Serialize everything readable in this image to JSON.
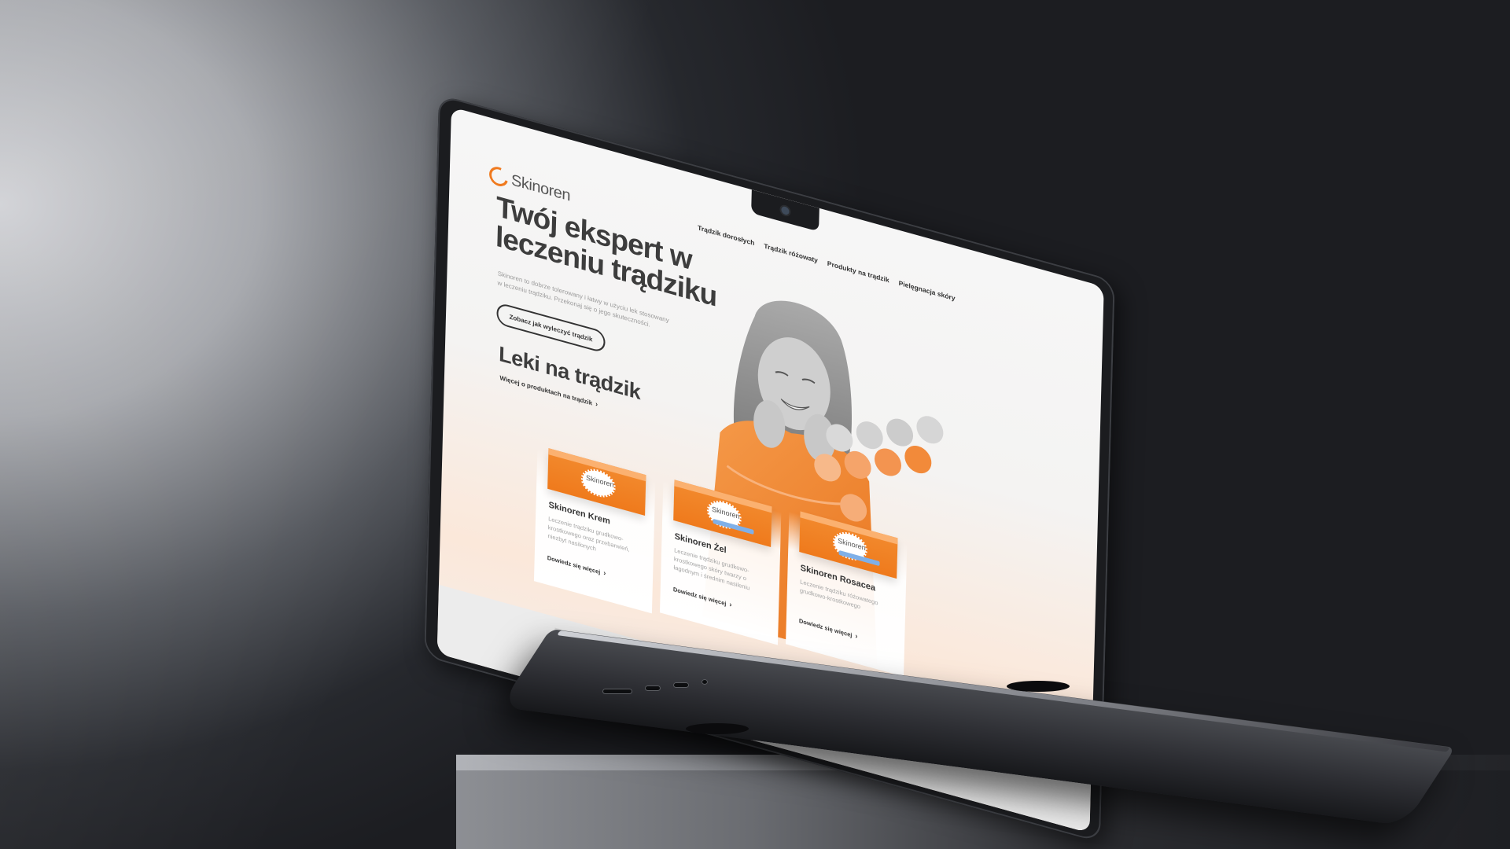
{
  "site": {
    "logo_text": "Skinoren",
    "nav": [
      "Trądzik dorosłych",
      "Trądzik różowaty",
      "Produkty na trądzik",
      "Pielęgnacja skóry"
    ],
    "hero": {
      "title": "Twój ekspert w leczeniu trądziku",
      "description": "Skinoren to dobrze tolerowany i łatwy w użyciu lek stosowany w leczeniu trądziku. Przekonaj się o jego skuteczności.",
      "cta_label": "Zobacz jak wyleczyć trądzik"
    },
    "products_section": {
      "title": "Leki na trądzik",
      "link_label": "Więcej o produktach na trądzik"
    },
    "products": [
      {
        "box_brand": "Skinoren",
        "name": "Skinoren Krem",
        "description": "Leczenie trądziku grudkowo-krostkowego oraz przebarwień, niezbyt nasilonych",
        "link_label": "Dowiedz się więcej"
      },
      {
        "box_brand": "Skinoren",
        "name": "Skinoren Żel",
        "description": "Leczenie trądziku grudkowo-krostkowego skóry twarzy o łagodnym i średnim nasileniu",
        "link_label": "Dowiedz się więcej"
      },
      {
        "box_brand": "Skinoren",
        "name": "Skinoren Rosacea",
        "description": "Leczenie trądziku różowatego grudkowo-krostkowego",
        "link_label": "Dowiedz się więcej"
      }
    ]
  },
  "colors": {
    "accent": "#f07a1f",
    "text_dark": "#3d3d3d",
    "text_muted": "#9a9a9a"
  },
  "icons": {
    "camera": "camera-icon",
    "chevron": "chevron-right-icon",
    "logo": "skinoren-logo-icon"
  }
}
